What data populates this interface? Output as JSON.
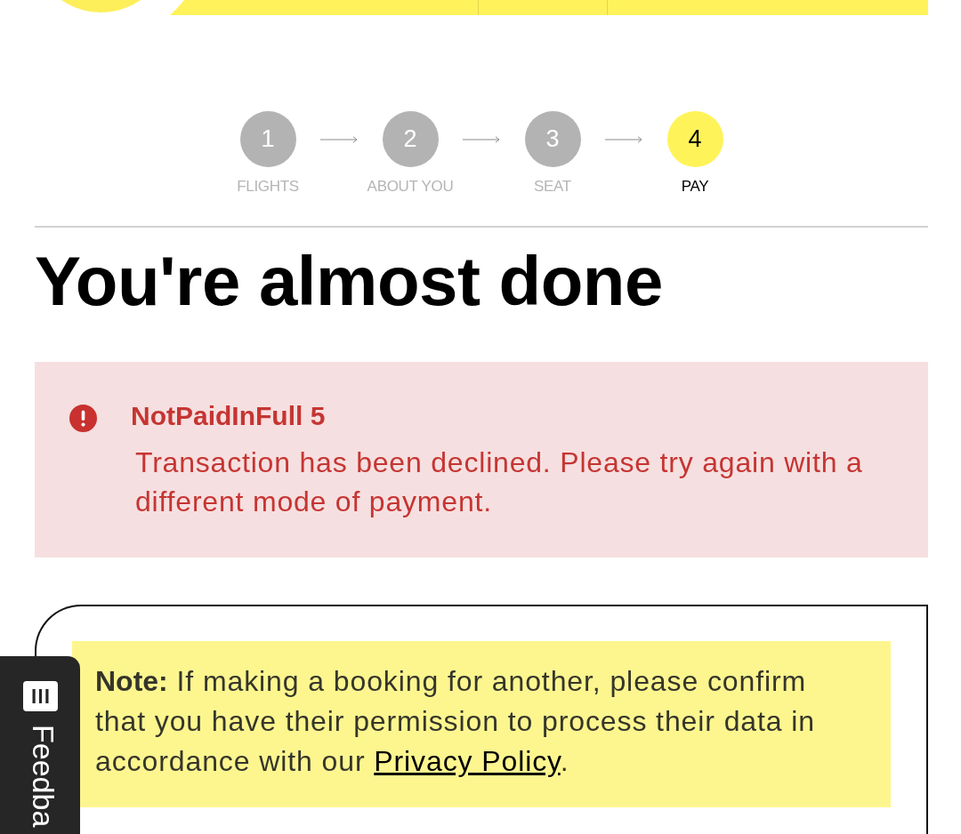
{
  "steps": [
    {
      "number": "1",
      "label": "FLIGHTS",
      "selected": false
    },
    {
      "number": "2",
      "label": "ABOUT YOU",
      "selected": false
    },
    {
      "number": "3",
      "label": "SEAT",
      "selected": false
    },
    {
      "number": "4",
      "label": "PAY",
      "selected": true
    }
  ],
  "heading": "You're almost done",
  "alert": {
    "kind": "error",
    "title": "NotPaidInFull 5",
    "message": "Transaction has been declined. Please try again with a different mode of payment."
  },
  "note": {
    "parts": [
      {
        "kind": "text",
        "text": "**Note:** If making a booking for another, please confirm that you have their permission to process their data in accordance with our "
      },
      {
        "kind": "link",
        "text": "Privacy Policy"
      },
      {
        "kind": "text",
        "text": "."
      }
    ]
  },
  "feedback_tab": {
    "label": "Feedba"
  }
}
